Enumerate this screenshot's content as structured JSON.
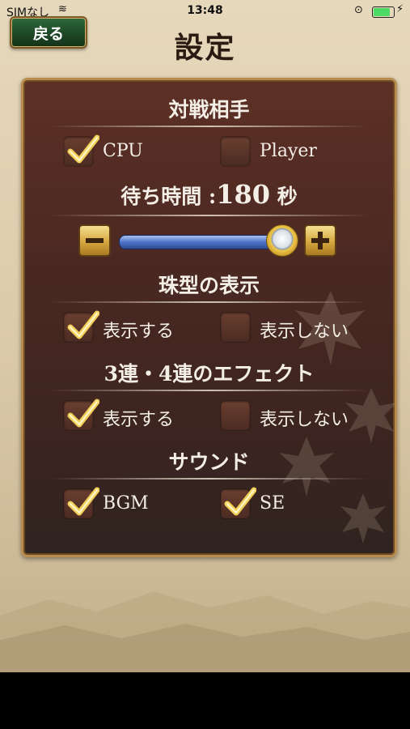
{
  "status_bar": {
    "carrier": "SIMなし",
    "time": "13:48"
  },
  "header": {
    "back_label": "戻る",
    "title": "設定"
  },
  "opponent": {
    "title": "対戦相手",
    "options": [
      {
        "label": "CPU",
        "checked": true
      },
      {
        "label": "Player",
        "checked": false
      }
    ]
  },
  "wait_time": {
    "label": "待ち時間 :",
    "value": "180",
    "unit": "秒",
    "slider_level": 0.9
  },
  "bead_display": {
    "title": "珠型の表示",
    "options": [
      {
        "label": "表示する",
        "checked": true
      },
      {
        "label": "表示しない",
        "checked": false
      }
    ]
  },
  "effect": {
    "title": "3連・4連のエフェクト",
    "options": [
      {
        "label": "表示する",
        "checked": true
      },
      {
        "label": "表示しない",
        "checked": false
      }
    ]
  },
  "sound": {
    "title": "サウンド",
    "options": [
      {
        "label": "BGM",
        "checked": true
      },
      {
        "label": "SE",
        "checked": true
      }
    ]
  },
  "icons": {
    "minus": "minus-icon",
    "plus": "plus-icon",
    "check": "check-icon"
  },
  "colors": {
    "panel": "#4a2822",
    "accent_gold": "#d5a63f",
    "slider_blue": "#4e73c6",
    "back_green": "#1c4524"
  }
}
